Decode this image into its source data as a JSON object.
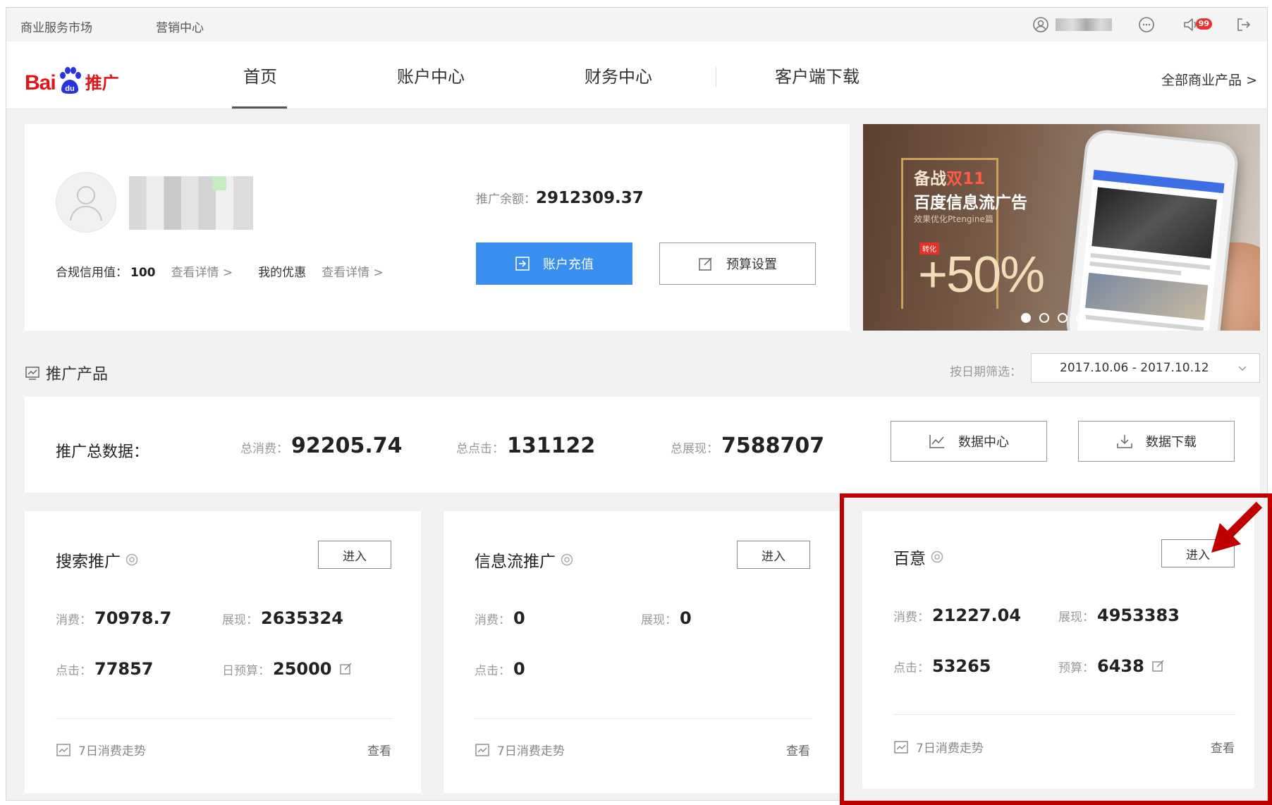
{
  "topbar": {
    "links": [
      "商业服务市场",
      "营销中心"
    ],
    "notification_count": "99"
  },
  "nav": {
    "logo": {
      "part1": "Bai",
      "part2": "du",
      "part3": "推广"
    },
    "items": [
      "首页",
      "账户中心",
      "财务中心",
      "客户端下载"
    ],
    "active": "首页",
    "all_products": "全部商业产品 >"
  },
  "account": {
    "credit_label": "合规信用值：",
    "credit_value": "100",
    "credit_link": "查看详情 >",
    "coupon_label": "我的优惠",
    "coupon_link": "查看详情 >",
    "balance_label": "推广余额：",
    "balance_value": "2912309.37",
    "recharge_button": "账户充值",
    "budget_button": "预算设置"
  },
  "banner": {
    "line1_a": "备战",
    "line1_b": "双11",
    "line2": "百度信息流广告",
    "line3": "效果优化Ptengine篇",
    "tag": "转化",
    "percent": "+50%",
    "active_slide": 1,
    "slides": 4
  },
  "section": {
    "title": "推广产品",
    "date_filter_label": "按日期筛选：",
    "date_range": "2017.10.06 - 2017.10.12"
  },
  "totals": {
    "title": "推广总数据：",
    "items": [
      {
        "label": "总消费：",
        "value": "92205.74"
      },
      {
        "label": "总点击：",
        "value": "131122"
      },
      {
        "label": "总展现：",
        "value": "7588707"
      }
    ],
    "data_center_button": "数据中心",
    "data_download_button": "数据下载"
  },
  "products": [
    {
      "name": "搜索推广",
      "enter": "进入",
      "m1_label": "消费：",
      "m1_value": "70978.7",
      "m2_label": "展现：",
      "m2_value": "2635324",
      "m3_label": "点击：",
      "m3_value": "77857",
      "m4_label": "日预算：",
      "m4_value": "25000",
      "trend": "7日消费走势",
      "view": "查看"
    },
    {
      "name": "信息流推广",
      "enter": "进入",
      "m1_label": "消费：",
      "m1_value": "0",
      "m2_label": "展现：",
      "m2_value": "0",
      "m3_label": "点击：",
      "m3_value": "0",
      "trend": "7日消费走势",
      "view": "查看"
    },
    {
      "name": "百意",
      "enter": "进入",
      "m1_label": "消费：",
      "m1_value": "21227.04",
      "m2_label": "展现：",
      "m2_value": "4953383",
      "m3_label": "点击：",
      "m3_value": "53265",
      "m4_label": "预算：",
      "m4_value": "6438",
      "trend": "7日消费走势",
      "view": "查看"
    }
  ],
  "colors": {
    "primary": "#3a8ef0",
    "brand_red": "#e0151b",
    "highlight": "#c00000"
  }
}
